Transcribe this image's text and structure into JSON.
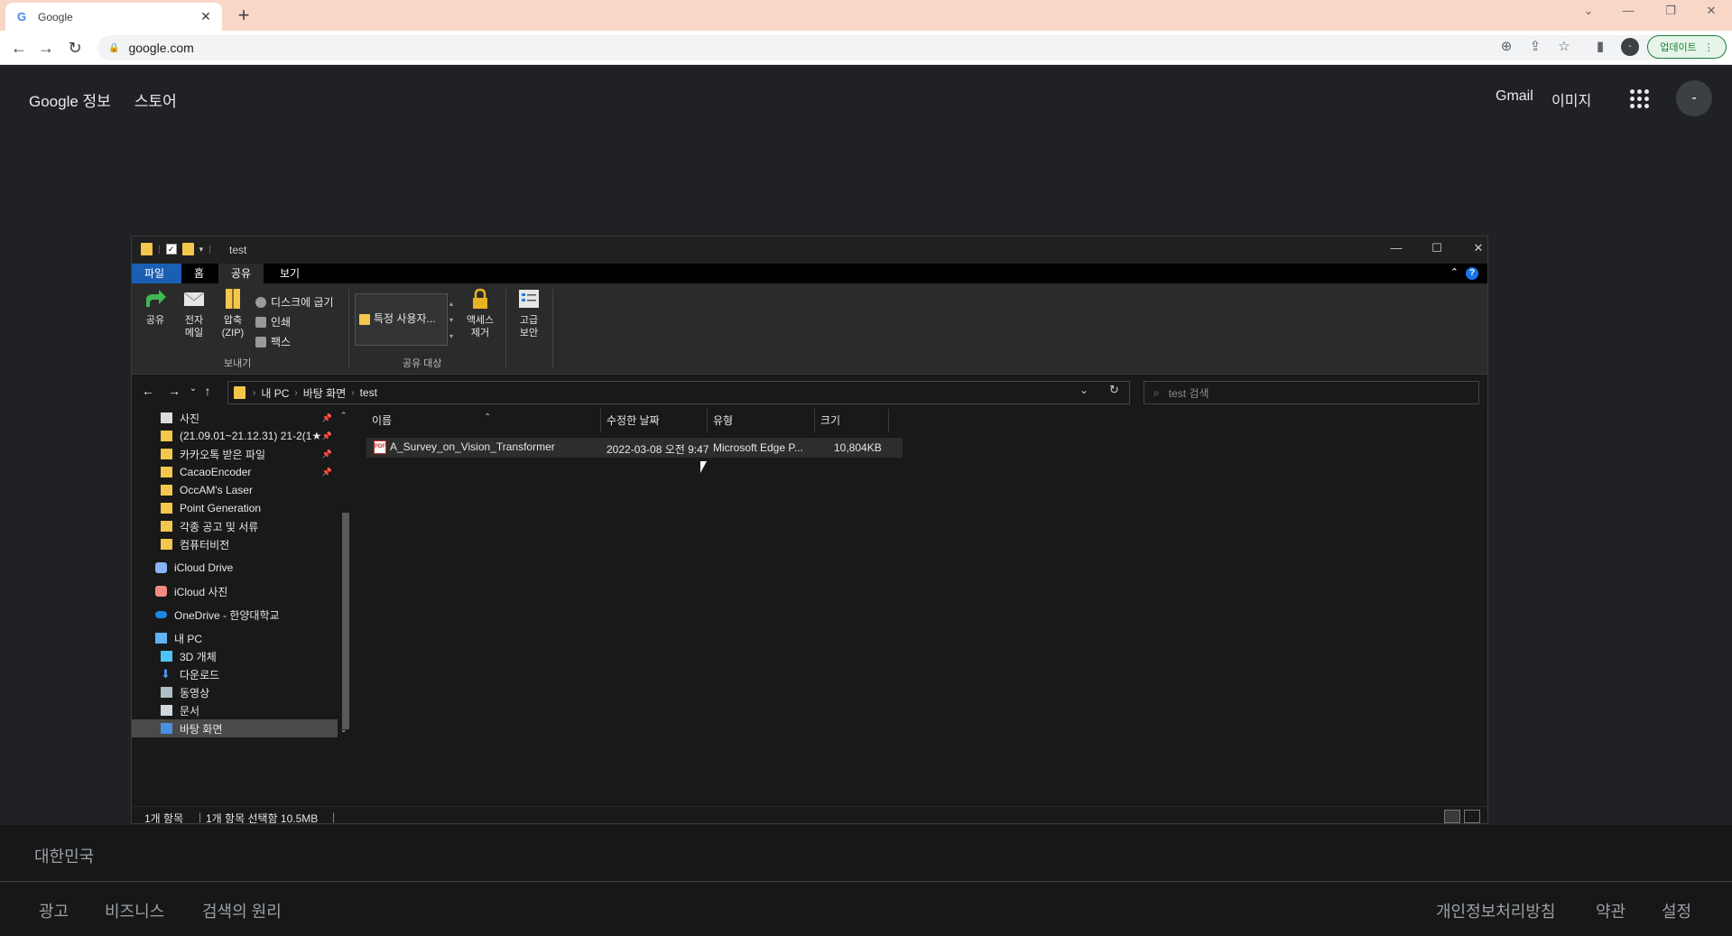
{
  "browser": {
    "tab_title": "Google",
    "url": "google.com",
    "update_label": "업데이트",
    "profile_initial": "-"
  },
  "google": {
    "header_left": [
      "Google 정보",
      "스토어"
    ],
    "gmail": "Gmail",
    "images": "이미지",
    "avatar_initial": "-",
    "footer_country": "대한민국",
    "footer_left": [
      "광고",
      "비즈니스",
      "검색의 원리"
    ],
    "footer_right": [
      "개인정보처리방침",
      "약관",
      "설정"
    ]
  },
  "explorer": {
    "title": "test",
    "tabs": [
      "파일",
      "홈",
      "공유",
      "보기"
    ],
    "ribbon": {
      "share": "공유",
      "email_line1": "전자",
      "email_line2": "메일",
      "zip_line1": "압축",
      "zip_line2": "(ZIP)",
      "burn": "디스크에 굽기",
      "print": "인쇄",
      "fax": "팩스",
      "send_group": "보내기",
      "specific_users": "특정 사용자...",
      "remove_access_line1": "액세스",
      "remove_access_line2": "제거",
      "advanced_line1": "고급",
      "advanced_line2": "보안",
      "share_group": "공유 대상"
    },
    "breadcrumb": [
      "내 PC",
      "바탕 화면",
      "test"
    ],
    "search_placeholder": "test 검색",
    "nav_items": [
      {
        "label": "사진",
        "pinned": true
      },
      {
        "label": "(21.09.01~21.12.31) 21-2(1★",
        "pinned": true
      },
      {
        "label": "카카오톡 받은 파일",
        "pinned": true
      },
      {
        "label": "CacaoEncoder",
        "pinned": true
      },
      {
        "label": "OccAM's Laser",
        "pinned": false
      },
      {
        "label": "Point Generation",
        "pinned": false
      },
      {
        "label": "각종 공고 및 서류",
        "pinned": false
      },
      {
        "label": "컴퓨터비전",
        "pinned": false
      },
      {
        "label": "iCloud Drive",
        "pinned": false
      },
      {
        "label": "iCloud 사진",
        "pinned": false
      },
      {
        "label": "OneDrive - 한양대학교",
        "pinned": false
      },
      {
        "label": "내 PC",
        "pinned": false
      },
      {
        "label": "3D 개체",
        "pinned": false
      },
      {
        "label": "다운로드",
        "pinned": false
      },
      {
        "label": "동영상",
        "pinned": false
      },
      {
        "label": "문서",
        "pinned": false
      },
      {
        "label": "바탕 화면",
        "pinned": false
      }
    ],
    "columns": [
      "이름",
      "수정한 날짜",
      "유형",
      "크기"
    ],
    "files": [
      {
        "name": "A_Survey_on_Vision_Transformer",
        "modified": "2022-03-08 오전 9:47",
        "type": "Microsoft Edge P...",
        "size": "10,804KB"
      }
    ],
    "status_count": "1개 항목",
    "status_selected": "1개 항목 선택함 10.5MB"
  }
}
